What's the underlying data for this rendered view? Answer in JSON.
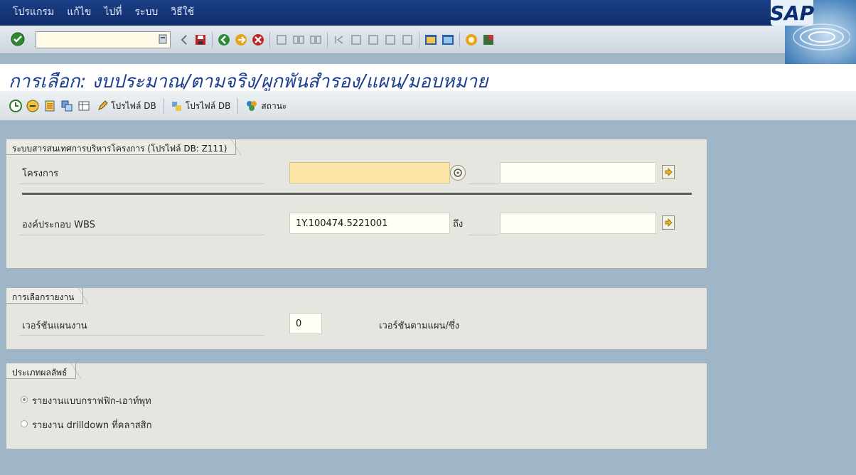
{
  "menu": {
    "items": [
      "โปรแกรม",
      "แก้ไข",
      "ไปที่",
      "ระบบ",
      "วิธีใช้"
    ]
  },
  "logo": "SAP",
  "title": "การเลือก: งบประมาณ/ตามจริง/ผูกพันสำรอง/แผน/มอบหมาย",
  "app_toolbar": {
    "profile_db_1": "โปรไฟล์ DB",
    "profile_db_2": "โปรไฟล์ DB",
    "status": "สถานะ"
  },
  "group_project": {
    "title": "ระบบสารสนเทศการบริหารโครงการ (โปรไฟล์ DB: Z111)",
    "project_label": "โครงการ",
    "project_value": "",
    "project_to_value": "",
    "wbs_label": "องค์ประกอบ WBS",
    "wbs_value": "1Y.100474.5221001",
    "to_label": "ถึง",
    "wbs_to_value": ""
  },
  "group_report": {
    "title": "การเลือกรายงาน",
    "plan_version_label": "เวอร์ชันแผนงาน",
    "plan_version_value": "0",
    "right_label": "เวอร์ชันตามแผน/ซึ่ง"
  },
  "group_output": {
    "title": "ประเภทผลลัพธ์",
    "options": [
      {
        "label": "รายงานแบบกราฟฟิก-เอาท์พุท",
        "selected": true
      },
      {
        "label": "รายงาน drilldown ที่คลาสสิก",
        "selected": false
      }
    ]
  },
  "colors": {
    "menubar": "#163a7c",
    "title": "#1e3f8f",
    "background": "#9fb5c8",
    "required_field": "#fbe6a7"
  }
}
